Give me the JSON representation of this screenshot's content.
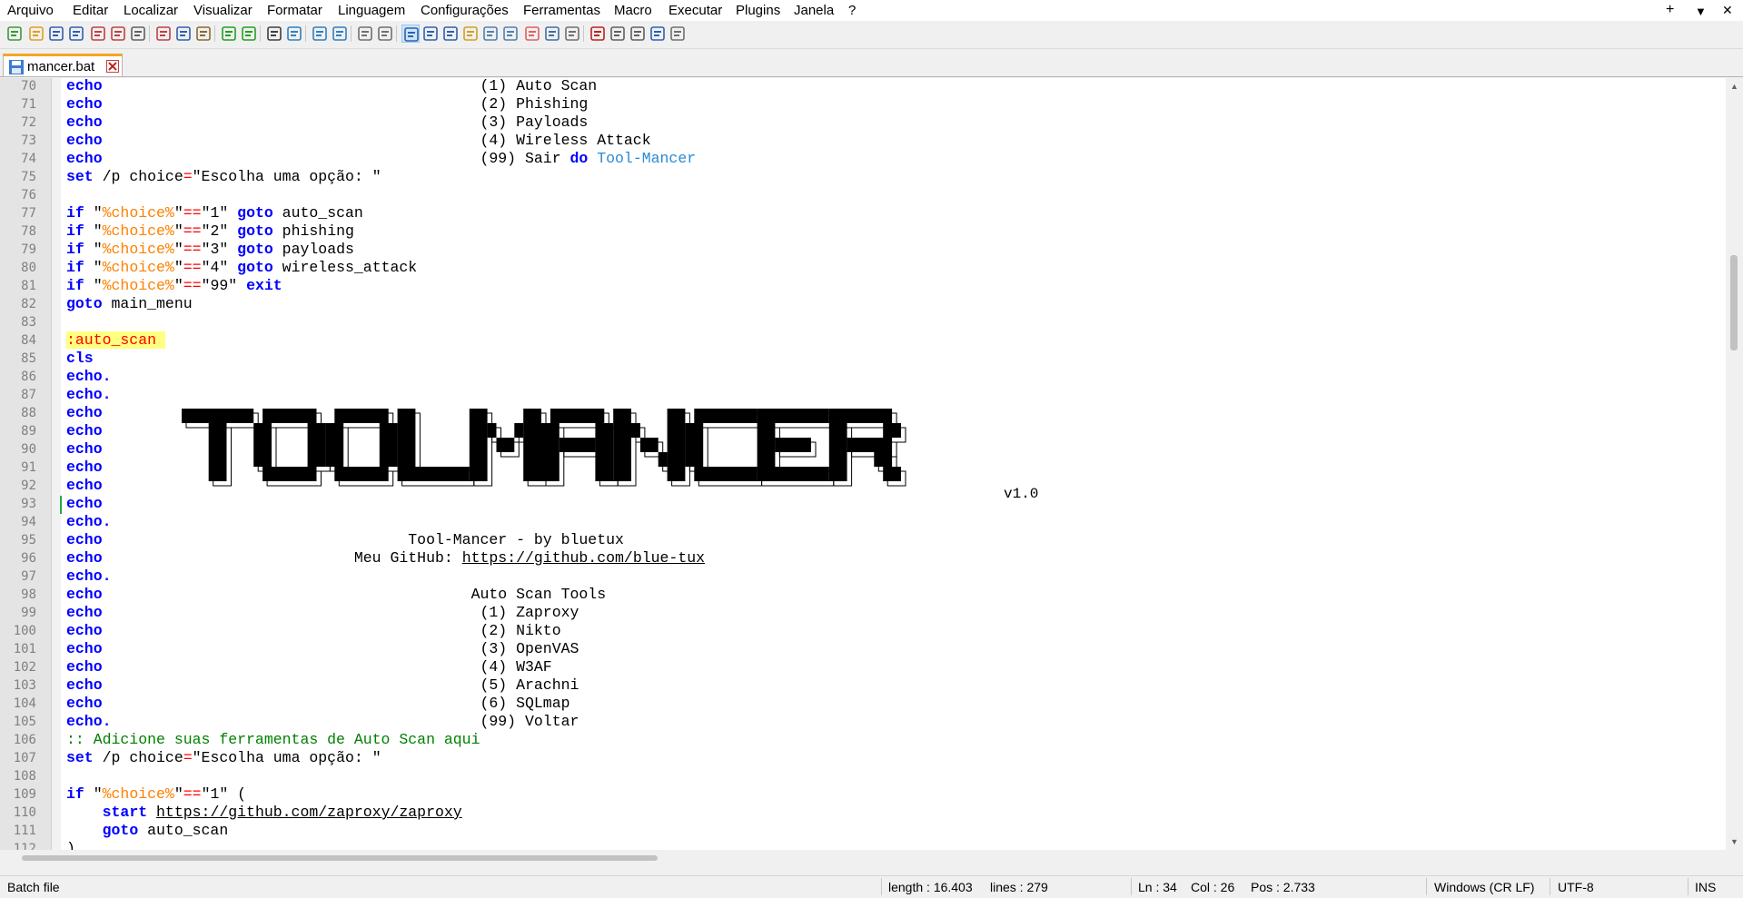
{
  "menu": {
    "items": [
      "Arquivo",
      "Editar",
      "Localizar",
      "Visualizar",
      "Formatar",
      "Linguagem",
      "Configurações",
      "Ferramentas",
      "Macro",
      "Executar",
      "Plugins",
      "Janela",
      "?"
    ],
    "plus": "+",
    "dropdown": "▼",
    "close": "✕"
  },
  "toolbar": {
    "icons": [
      "new-file-icon",
      "open-file-icon",
      "save-icon",
      "save-all-icon",
      "close-file-icon",
      "close-all-icon",
      "print-icon",
      "cut-icon",
      "copy-icon",
      "paste-icon",
      "undo-icon",
      "redo-icon",
      "find-icon",
      "replace-icon",
      "zoom-in-icon",
      "zoom-out-icon",
      "sync-vertical-icon",
      "sync-horizontal-icon",
      "word-wrap-icon",
      "show-all-chars-icon",
      "indent-guide-icon",
      "user-language-icon",
      "doc-map-icon",
      "function-list-icon",
      "folder-workspace-icon",
      "monitoring-icon",
      "doc-switcher-icon",
      "record-macro-icon",
      "stop-record-icon",
      "play-macro-icon",
      "run-macro-multiple-icon",
      "save-macro-icon"
    ]
  },
  "tab": {
    "label": "mancer.bat"
  },
  "editor": {
    "line_numbers": [
      "70",
      "71",
      "72",
      "73",
      "74",
      "75",
      "76",
      "77",
      "78",
      "79",
      "80",
      "81",
      "82",
      "83",
      "84",
      "85",
      "86",
      "87",
      "88",
      "89",
      "90",
      "91",
      "92",
      "93",
      "94",
      "95",
      "96",
      "97",
      "98",
      "99",
      "100",
      "101",
      "102",
      "103",
      "104",
      "105",
      "106",
      "107",
      "108",
      "109",
      "110",
      "111",
      "112"
    ],
    "banner_version": "v1.0",
    "banner_art": "TOOLMANCER"
  },
  "status": {
    "file_type": "Batch file",
    "length": "length : 16.403",
    "lines": "lines : 279",
    "ln": "Ln : 34",
    "col": "Col : 26",
    "pos": "Pos : 2.733",
    "eol": "Windows (CR LF)",
    "encoding": "UTF-8",
    "mode": "INS"
  },
  "colors": {
    "keyword": "#0000ff",
    "variable": "#ff8000",
    "operator": "#ff0000",
    "comment": "#008000",
    "tab_accent": "#f5a623",
    "label_highlight": "#ffff80"
  }
}
